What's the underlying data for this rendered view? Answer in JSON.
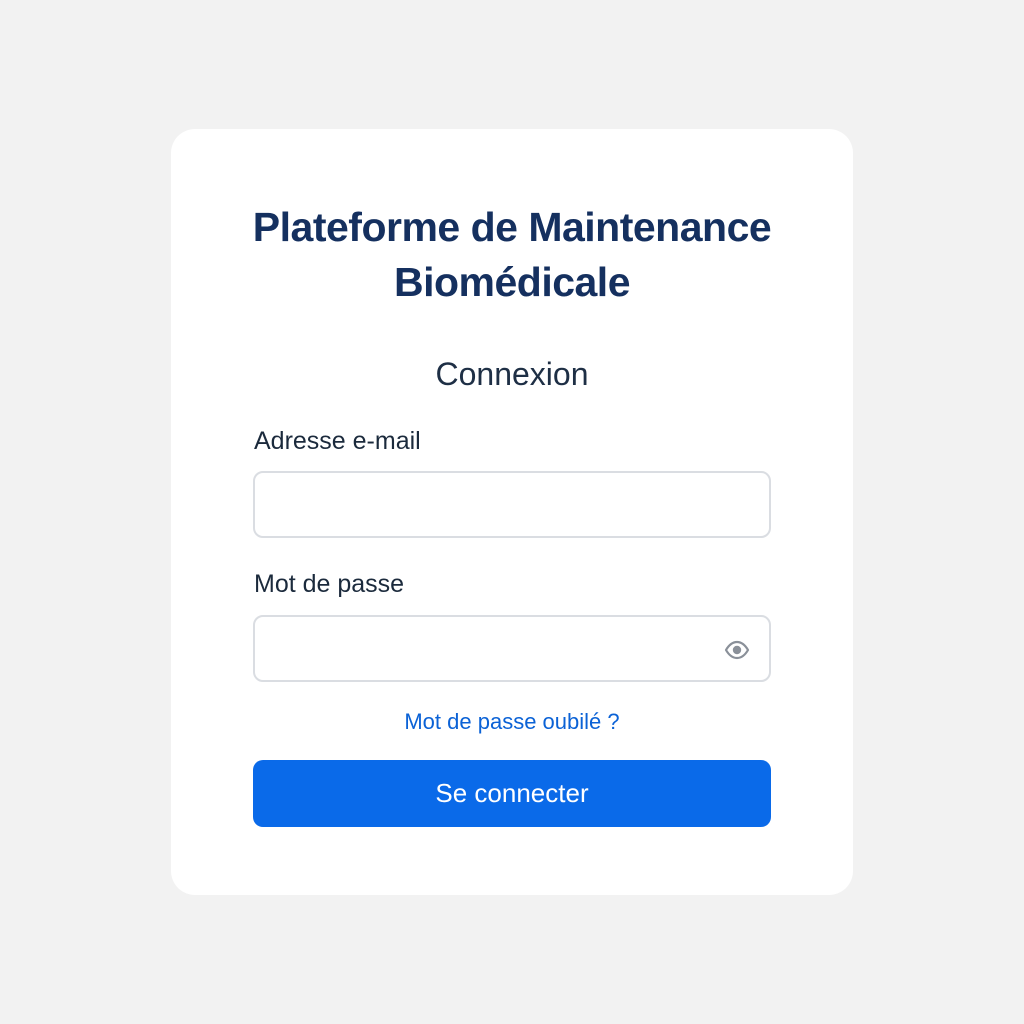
{
  "header": {
    "title_line1": "Plateforme de Maintenance",
    "title_line2": "Biomédicale"
  },
  "form": {
    "title": "Connexion",
    "email": {
      "label": "Adresse e-mail",
      "value": "",
      "placeholder": ""
    },
    "password": {
      "label": "Mot de passe",
      "value": "",
      "placeholder": "",
      "toggle_icon": "eye-icon"
    },
    "forgot_password_link": "Mot de passe oubilé ?",
    "submit_label": "Se connecter"
  },
  "colors": {
    "page_background": "#f2f2f2",
    "card_background": "#ffffff",
    "title": "#15305f",
    "link": "#0b62d6",
    "primary_button": "#0a6ae9"
  }
}
